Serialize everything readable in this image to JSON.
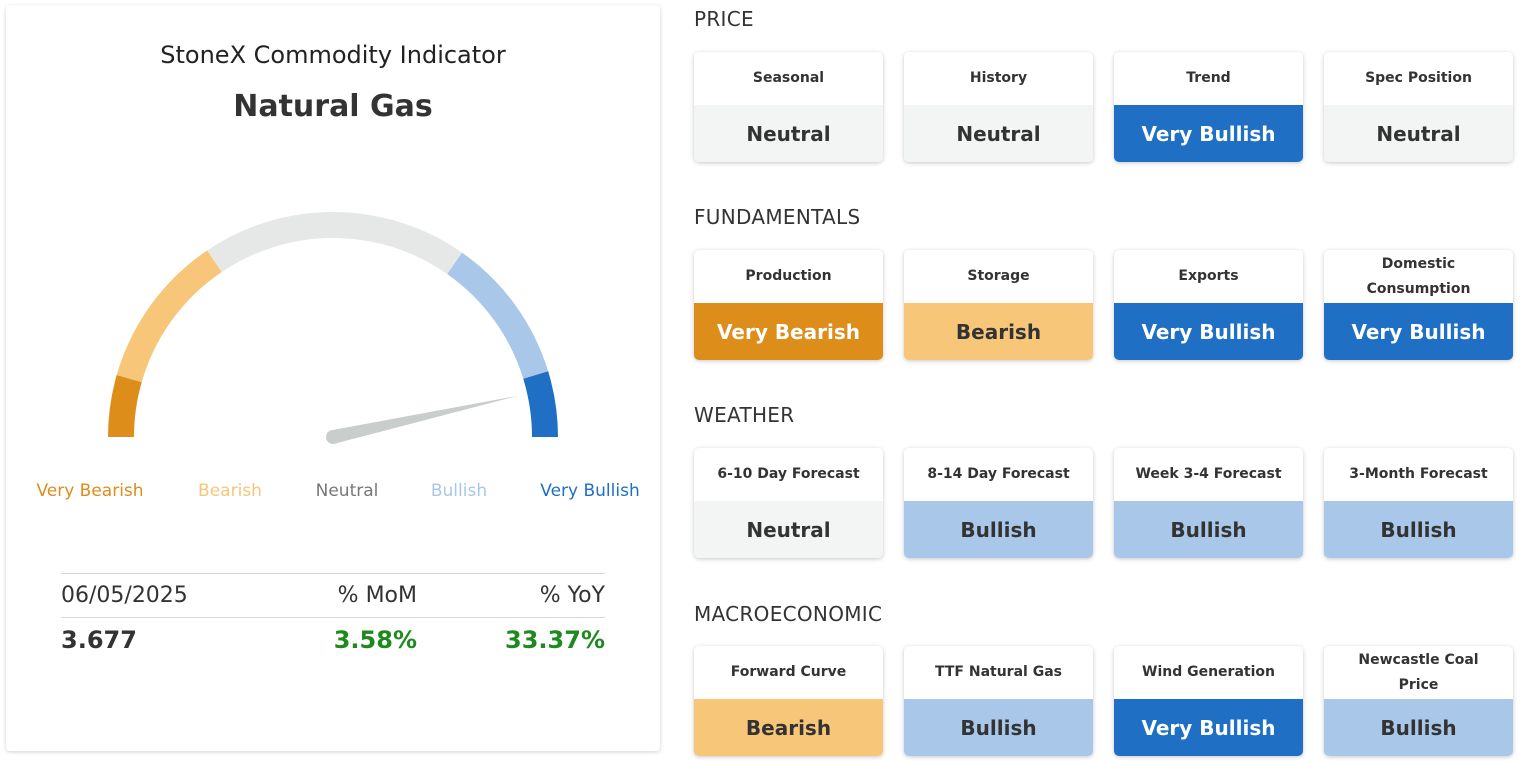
{
  "gauge": {
    "title": "StoneX Commodity Indicator",
    "commodity": "Natural Gas",
    "reading_fraction": 0.93,
    "labels": [
      {
        "text": "Very Bearish",
        "color": "#dc8d1a"
      },
      {
        "text": "Bearish",
        "color": "#f7c679"
      },
      {
        "text": "Neutral",
        "color": "#777777"
      },
      {
        "text": "Bullish",
        "color": "#a9c7e8"
      },
      {
        "text": "Very Bullish",
        "color": "#1f6fc5"
      }
    ]
  },
  "stats": {
    "date": "06/05/2025",
    "mom_label": "% MoM",
    "yoy_label": "% YoY",
    "price": "3.677",
    "mom_value": "3.58%",
    "yoy_value": "33.37%"
  },
  "colors": {
    "Very Bearish": {
      "bg": "#dc8d1a",
      "fg": "#ffffff"
    },
    "Bearish": {
      "bg": "#f7c679",
      "fg": "#333333"
    },
    "Neutral": {
      "bg": "#f3f4f4",
      "fg": "#333333"
    },
    "Bullish": {
      "bg": "#a9c7e8",
      "fg": "#333333"
    },
    "Very Bullish": {
      "bg": "#1f6fc5",
      "fg": "#ffffff"
    }
  },
  "sections": [
    {
      "title": "PRICE",
      "tiles": [
        {
          "label": "Seasonal",
          "value": "Neutral"
        },
        {
          "label": "History",
          "value": "Neutral"
        },
        {
          "label": "Trend",
          "value": "Very Bullish"
        },
        {
          "label": "Spec Position",
          "value": "Neutral"
        }
      ]
    },
    {
      "title": "FUNDAMENTALS",
      "tiles": [
        {
          "label": "Production",
          "value": "Very Bearish"
        },
        {
          "label": "Storage",
          "value": "Bearish"
        },
        {
          "label": "Exports",
          "value": "Very Bullish"
        },
        {
          "label": "Domestic Consumption",
          "value": "Very Bullish"
        }
      ]
    },
    {
      "title": "WEATHER",
      "tiles": [
        {
          "label": "6-10 Day Forecast",
          "value": "Neutral"
        },
        {
          "label": "8-14 Day Forecast",
          "value": "Bullish"
        },
        {
          "label": "Week 3-4 Forecast",
          "value": "Bullish"
        },
        {
          "label": "3-Month Forecast",
          "value": "Bullish"
        }
      ]
    },
    {
      "title": "MACROECONOMIC",
      "tiles": [
        {
          "label": "Forward Curve",
          "value": "Bearish"
        },
        {
          "label": "TTF Natural Gas",
          "value": "Bullish"
        },
        {
          "label": "Wind Generation",
          "value": "Very Bullish"
        },
        {
          "label": "Newcastle Coal Price",
          "value": "Bullish"
        }
      ]
    }
  ]
}
